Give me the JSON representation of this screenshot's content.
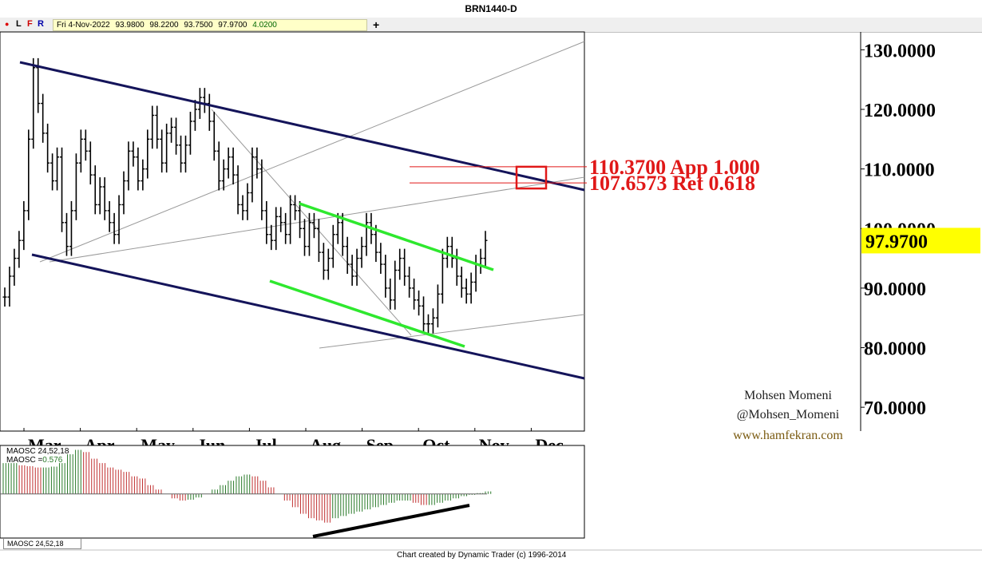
{
  "window": {
    "title": "BRN1440-D"
  },
  "toolbar": {
    "buttons": [
      "L",
      "F",
      "R"
    ],
    "info": {
      "date": "Fri 4-Nov-2022",
      "open": "93.9800",
      "high": "98.2200",
      "low": "93.7500",
      "close": "97.9700",
      "change": "4.0200"
    },
    "plus": "+"
  },
  "chart_data": {
    "type": "bar",
    "title": "BRN1440-D",
    "ylim": [
      66,
      133
    ],
    "y_ticks": [
      "130.0000",
      "120.0000",
      "110.0000",
      "100.0000",
      "90.0000",
      "80.0000",
      "70.0000"
    ],
    "y_tick_values": [
      130,
      120,
      110,
      100,
      90,
      80,
      70
    ],
    "x_ticks": [
      "Mar",
      "Apr",
      "May",
      "Jun",
      "Jul",
      "Aug",
      "Sep",
      "Oct",
      "Nov",
      "Dec"
    ],
    "last_price": "97.9700",
    "last_price_value": 97.97,
    "annotations": [
      {
        "text": "110.3700 App 1.000",
        "value": 110.37
      },
      {
        "text": "107.6573 Ret 0.618",
        "value": 107.6573
      }
    ],
    "series": [
      {
        "name": "Price",
        "values": [
          88.5,
          92,
          95,
          98,
          103,
          115,
          127,
          121,
          116,
          111,
          108,
          112,
          101,
          97,
          103,
          111,
          115,
          113,
          109,
          104,
          107,
          103,
          101,
          99,
          104,
          108,
          113,
          112,
          108,
          110,
          115,
          119,
          115,
          111,
          116,
          117,
          114,
          111,
          114,
          118,
          120,
          122,
          121,
          118,
          113,
          108,
          110,
          112,
          109,
          104,
          103,
          106,
          112,
          110,
          103,
          99,
          98,
          102,
          101,
          99,
          104,
          103,
          100,
          97,
          101,
          100,
          96,
          93,
          95,
          99,
          101,
          97,
          94,
          92,
          95,
          97,
          101,
          99,
          96,
          94,
          90,
          88,
          93,
          95,
          92,
          90,
          88,
          87,
          84,
          84,
          85,
          89,
          95,
          97,
          95,
          92,
          90,
          89,
          91,
          94,
          95,
          98
        ]
      },
      {
        "name": "MAOSC 24,52,18",
        "values": [
          7,
          7,
          6.5,
          6.3,
          6,
          6,
          6.2,
          7,
          9,
          10,
          9.5,
          8,
          7,
          6,
          5.5,
          5,
          4,
          3.5,
          2,
          1,
          0,
          -1,
          -1.5,
          -1.3,
          -0.8,
          0,
          1,
          2,
          3,
          4,
          4.4,
          4,
          3,
          1.5,
          0,
          -1.5,
          -3,
          -4.5,
          -5.5,
          -6,
          -6.5,
          -5.5,
          -5,
          -4.5,
          -4,
          -3.5,
          -3,
          -2.5,
          -2,
          -1.5,
          -1.5,
          -2,
          -2.5,
          -2.5,
          -2,
          -1.5,
          -1,
          -0.5,
          -0.2,
          0.2,
          0.576
        ]
      }
    ],
    "oscillator_label_1": "MAOSC 24,52,18",
    "oscillator_label_2": "MAOSC =",
    "oscillator_value": "0.576",
    "oscillator_tab": "MAOSC 24,52,18"
  },
  "watermark": {
    "name": "Mohsen Momeni",
    "handle": "@Mohsen_Momeni",
    "site": "www.hamfekran.com"
  },
  "footer": "Chart created by Dynamic Trader  (c) 1996-2014",
  "colors": {
    "channel": "#14145a",
    "green_channel": "#2ee82e",
    "target": "#e01818",
    "last_price_bg": "#ffff00",
    "osc_up": "#2a7a2a",
    "osc_down": "#c03030"
  }
}
